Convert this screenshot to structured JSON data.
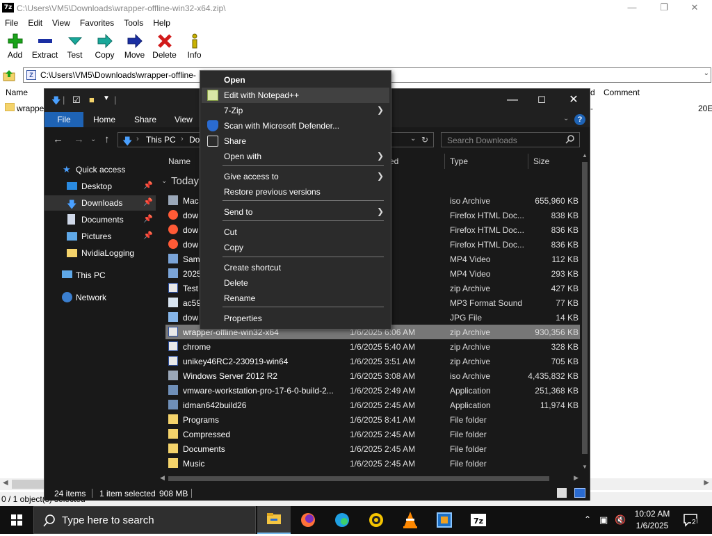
{
  "zip": {
    "title": "C:\\Users\\VM5\\Downloads\\wrapper-offline-win32-x64.zip\\",
    "logo": "7z",
    "menu": [
      "File",
      "Edit",
      "View",
      "Favorites",
      "Tools",
      "Help"
    ],
    "toolbar": [
      {
        "label": "Add",
        "icon": "add-icon",
        "color": "#1aa31a"
      },
      {
        "label": "Extract",
        "icon": "extract-icon",
        "color": "#1a2fa3"
      },
      {
        "label": "Test",
        "icon": "test-icon",
        "color": "#19a89a"
      },
      {
        "label": "Copy",
        "icon": "copy-icon",
        "color": "#19a89a"
      },
      {
        "label": "Move",
        "icon": "move-icon",
        "color": "#1a2fa3"
      },
      {
        "label": "Delete",
        "icon": "delete-icon",
        "color": "#d11a1a"
      },
      {
        "label": "Info",
        "icon": "info-icon",
        "color": "#c9b200"
      }
    ],
    "address": "C:\\Users\\VM5\\Downloads\\wrapper-offline-",
    "columns": {
      "name": "Name",
      "comment": "Comment",
      "d_fragment": "d"
    },
    "row": {
      "name": "wrappe",
      "size": "20E"
    },
    "status": "0 / 1 object(s) selected"
  },
  "explorer": {
    "ribbon": {
      "file": "File",
      "home": "Home",
      "share": "Share",
      "view": "View"
    },
    "breadcrumb": {
      "root": "This PC",
      "current": "Do"
    },
    "search_placeholder": "Search Downloads",
    "columns": {
      "name": "Name",
      "modified_fragment": "ed",
      "type": "Type",
      "size": "Size"
    },
    "group": "Today",
    "sidebar": [
      {
        "label": "Quick access",
        "icon": "star-icon",
        "pinned": false
      },
      {
        "label": "Desktop",
        "icon": "desktop-icon",
        "pinned": true
      },
      {
        "label": "Downloads",
        "icon": "download-icon",
        "pinned": true,
        "selected": true
      },
      {
        "label": "Documents",
        "icon": "document-icon",
        "pinned": true
      },
      {
        "label": "Pictures",
        "icon": "picture-icon",
        "pinned": true
      },
      {
        "label": "NvidiaLogging",
        "icon": "folder-icon",
        "pinned": false
      },
      {
        "label": "This PC",
        "icon": "computer-icon",
        "pinned": false
      },
      {
        "label": "Network",
        "icon": "network-icon",
        "pinned": false
      }
    ],
    "files": [
      {
        "name": "Mac",
        "date": "8 AM",
        "type": "iso Archive",
        "size": "655,960 KB",
        "icon": "iso-icon"
      },
      {
        "name": "dow",
        "date": "3 AM",
        "type": "Firefox HTML Doc...",
        "size": "838 KB",
        "icon": "firefox-doc-icon"
      },
      {
        "name": "dow",
        "date": "1 AM",
        "type": "Firefox HTML Doc...",
        "size": "836 KB",
        "icon": "firefox-doc-icon"
      },
      {
        "name": "dow",
        "date": "1 AM",
        "type": "Firefox HTML Doc...",
        "size": "836 KB",
        "icon": "firefox-doc-icon"
      },
      {
        "name": "Sam",
        "date": "2 AM",
        "type": "MP4 Video",
        "size": "112 KB",
        "icon": "video-icon"
      },
      {
        "name": "2025",
        "date": "1 AM",
        "type": "MP4 Video",
        "size": "293 KB",
        "icon": "video-icon"
      },
      {
        "name": "Test",
        "date": "3 AM",
        "type": "zip Archive",
        "size": "427 KB",
        "icon": "zip-icon"
      },
      {
        "name": "ac59",
        "date": "8 AM",
        "type": "MP3 Format Sound",
        "size": "77 KB",
        "icon": "audio-icon"
      },
      {
        "name": "dow",
        "date": "9 AM",
        "type": "JPG File",
        "size": "14 KB",
        "icon": "image-icon"
      },
      {
        "name": "wrapper-offline-win32-x64",
        "date": "1/6/2025 6:06 AM",
        "type": "zip Archive",
        "size": "930,356 KB",
        "icon": "zip-icon",
        "selected": true
      },
      {
        "name": "chrome",
        "date": "1/6/2025 5:40 AM",
        "type": "zip Archive",
        "size": "328 KB",
        "icon": "zip-icon"
      },
      {
        "name": "unikey46RC2-230919-win64",
        "date": "1/6/2025 3:51 AM",
        "type": "zip Archive",
        "size": "705 KB",
        "icon": "zip-icon"
      },
      {
        "name": "Windows Server 2012 R2",
        "date": "1/6/2025 3:08 AM",
        "type": "iso Archive",
        "size": "4,435,832 KB",
        "icon": "iso-icon"
      },
      {
        "name": "vmware-workstation-pro-17-6-0-build-2...",
        "date": "1/6/2025 2:49 AM",
        "type": "Application",
        "size": "251,368 KB",
        "icon": "app-icon"
      },
      {
        "name": "idman642build26",
        "date": "1/6/2025 2:45 AM",
        "type": "Application",
        "size": "11,974 KB",
        "icon": "app-icon"
      },
      {
        "name": "Programs",
        "date": "1/6/2025 8:41 AM",
        "type": "File folder",
        "size": "",
        "icon": "folder-icon"
      },
      {
        "name": "Compressed",
        "date": "1/6/2025 2:45 AM",
        "type": "File folder",
        "size": "",
        "icon": "folder-icon"
      },
      {
        "name": "Documents",
        "date": "1/6/2025 2:45 AM",
        "type": "File folder",
        "size": "",
        "icon": "folder-icon"
      },
      {
        "name": "Music",
        "date": "1/6/2025 2:45 AM",
        "type": "File folder",
        "size": "",
        "icon": "folder-icon"
      }
    ],
    "status": {
      "items": "24 items",
      "selected": "1 item selected",
      "size": "908 MB"
    }
  },
  "context_menu": {
    "items": [
      {
        "label": "Open",
        "bold": true
      },
      {
        "label": "Edit with Notepad++",
        "icon": "notepadpp-icon",
        "hover": true
      },
      {
        "label": "7-Zip",
        "submenu": true
      },
      {
        "label": "Scan with Microsoft Defender...",
        "icon": "defender-icon"
      },
      {
        "label": "Share",
        "icon": "share-icon"
      },
      {
        "label": "Open with",
        "submenu": true
      },
      {
        "label": "Give access to",
        "submenu": true
      },
      {
        "label": "Restore previous versions"
      },
      {
        "label": "Send to",
        "submenu": true
      },
      {
        "label": "Cut"
      },
      {
        "label": "Copy"
      },
      {
        "label": "Create shortcut"
      },
      {
        "label": "Delete"
      },
      {
        "label": "Rename"
      },
      {
        "label": "Properties"
      }
    ]
  },
  "taskbar": {
    "search_placeholder": "Type here to search",
    "time": "10:02 AM",
    "date": "1/6/2025",
    "notification_count": "2",
    "apps": [
      "file-explorer-icon",
      "firefox-icon",
      "edge-icon",
      "app-circle-icon",
      "vlc-icon",
      "virtualbox-icon",
      "7zip-icon"
    ]
  }
}
